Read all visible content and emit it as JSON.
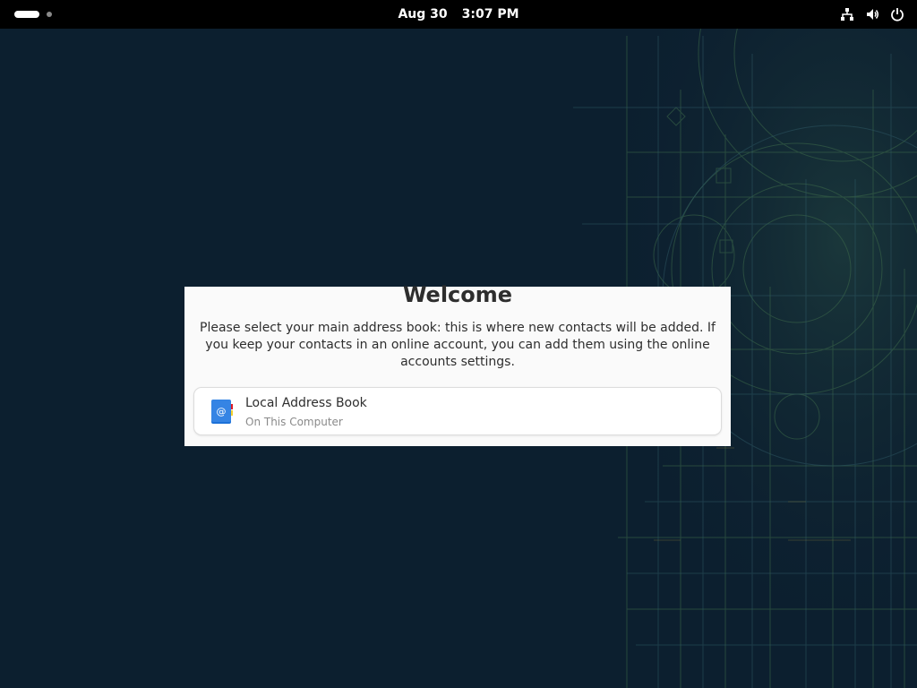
{
  "topbar": {
    "date": "Aug 30",
    "time": "3:07 PM",
    "tray_icons": [
      "network-icon",
      "volume-icon",
      "power-icon"
    ]
  },
  "dialog": {
    "title": "Welcome",
    "description": "Please select your main address book: this is where new contacts will be added. If you keep your contacts in an online account, you can add them using the online accounts settings.",
    "address_books": [
      {
        "name": "Local Address Book",
        "location": "On This Computer",
        "icon": "address-book-icon"
      }
    ]
  },
  "colors": {
    "desktop_bg": "#0c1f2f",
    "topbar_bg": "#000000",
    "dialog_bg": "#fafafa",
    "accent_blue": "#3584e4"
  }
}
